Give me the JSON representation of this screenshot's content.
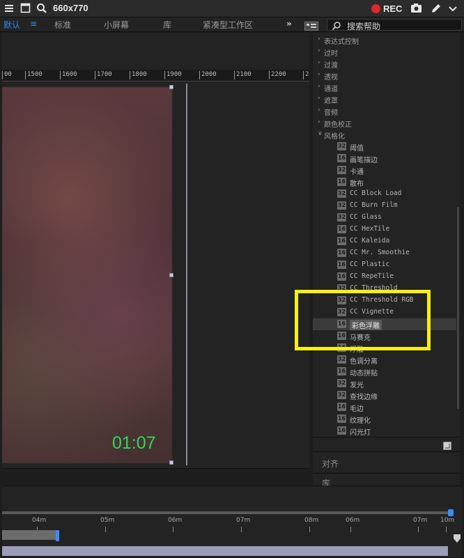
{
  "capture_bar": {
    "dimensions": "660x770",
    "rec_label": "REC",
    "icons": [
      "menu-icon",
      "window-icon",
      "magnifier-icon",
      "record-icon",
      "camera-icon",
      "pencil-icon",
      "chevron-down-icon"
    ]
  },
  "workspace_bar": {
    "items": [
      "默认",
      "标准",
      "小屏幕",
      "库",
      "紧凑型工作区"
    ],
    "active_item": "默认",
    "more": "»",
    "search_placeholder": "搜索帮助"
  },
  "viewer": {
    "ruler_ticks": [
      "00",
      "1500",
      "1600",
      "1700",
      "1800",
      "1900",
      "2000",
      "2100",
      "2200",
      "2"
    ],
    "timecode": "01:07"
  },
  "effects_panel": {
    "rows": [
      {
        "type": "category",
        "label": "表达式控制",
        "expanded": false
      },
      {
        "type": "category",
        "label": "过时",
        "expanded": false
      },
      {
        "type": "category",
        "label": "过渡",
        "expanded": false
      },
      {
        "type": "category",
        "label": "透视",
        "expanded": false
      },
      {
        "type": "category",
        "label": "通道",
        "expanded": false
      },
      {
        "type": "category",
        "label": "遮罩",
        "expanded": false
      },
      {
        "type": "category",
        "label": "音频",
        "expanded": false
      },
      {
        "type": "category",
        "label": "颜色校正",
        "expanded": false
      },
      {
        "type": "category",
        "label": "风格化",
        "expanded": true
      },
      {
        "type": "effect",
        "badge": "32",
        "label": "阈值"
      },
      {
        "type": "effect",
        "badge": "16",
        "label": "画笔描边"
      },
      {
        "type": "effect",
        "badge": "32",
        "label": "卡通"
      },
      {
        "type": "effect",
        "badge": "16",
        "label": "散布"
      },
      {
        "type": "effect",
        "badge": "32",
        "label": "CC Block Load"
      },
      {
        "type": "effect",
        "badge": "32",
        "label": "CC Burn Film"
      },
      {
        "type": "effect",
        "badge": "32",
        "label": "CC Glass"
      },
      {
        "type": "effect",
        "badge": "16",
        "label": "CC HexTile"
      },
      {
        "type": "effect",
        "badge": "16",
        "label": "CC Kaleida"
      },
      {
        "type": "effect",
        "badge": "16",
        "label": "CC Mr. Smoothie"
      },
      {
        "type": "effect",
        "badge": "16",
        "label": "CC Plastic"
      },
      {
        "type": "effect",
        "badge": "16",
        "label": "CC RepeTile"
      },
      {
        "type": "effect",
        "badge": "32",
        "label": "CC Threshold"
      },
      {
        "type": "effect",
        "badge": "32",
        "label": "CC Threshold RGB"
      },
      {
        "type": "effect",
        "badge": "32",
        "label": "CC Vignette"
      },
      {
        "type": "effect",
        "badge": "16",
        "label": "彩色浮雕",
        "selected": true
      },
      {
        "type": "effect",
        "badge": "16",
        "label": "马赛克"
      },
      {
        "type": "effect",
        "badge": "16",
        "label": "浮雕"
      },
      {
        "type": "effect",
        "badge": "32",
        "label": "色调分离"
      },
      {
        "type": "effect",
        "badge": "16",
        "label": "动态拼贴"
      },
      {
        "type": "effect",
        "badge": "32",
        "label": "发光"
      },
      {
        "type": "effect",
        "badge": "32",
        "label": "查找边缘"
      },
      {
        "type": "effect",
        "badge": "16",
        "label": "毛边"
      },
      {
        "type": "effect",
        "badge": "16",
        "label": "纹理化"
      },
      {
        "type": "effect",
        "badge": "16",
        "label": "闪光灯"
      }
    ]
  },
  "panels": {
    "align_title": "对齐",
    "library_title": "库"
  },
  "timeline": {
    "ticks": [
      "04m",
      "05m",
      "06m",
      "07m",
      "08m",
      "06m",
      "07m",
      "10m"
    ]
  },
  "colors": {
    "accent": "#2d8ceb",
    "timecode": "#2ed85a",
    "highlight": "#f8ef12",
    "record": "#e3262a"
  }
}
